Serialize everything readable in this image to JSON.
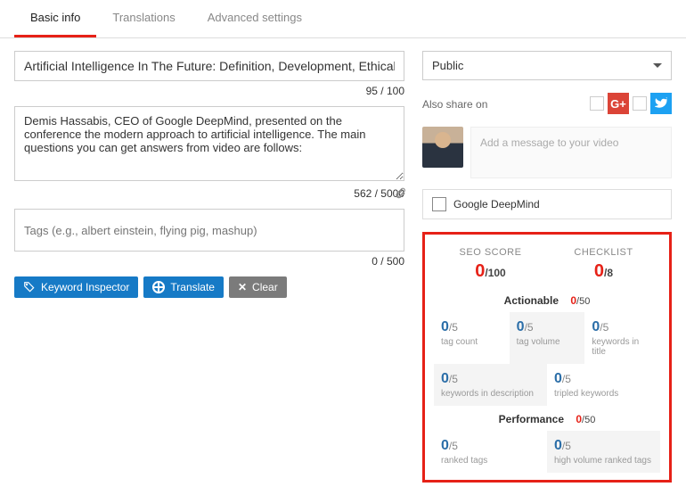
{
  "tabs": {
    "basic": "Basic info",
    "translations": "Translations",
    "advanced": "Advanced settings"
  },
  "title": {
    "value": "Artificial Intelligence In The Future: Definition, Development, Ethical Iss",
    "counter": "95 / 100"
  },
  "description": {
    "value": "Demis Hassabis, CEO of Google DeepMind, presented on the conference the modern approach to artificial intelligence. The main questions you can get answers from video are follows:",
    "counter": "562 / 5000"
  },
  "tags": {
    "placeholder": "Tags (e.g., albert einstein, flying pig, mashup)",
    "counter": "0 / 500"
  },
  "buttons": {
    "keyword": "Keyword Inspector",
    "translate": "Translate",
    "clear": "Clear"
  },
  "privacy": {
    "value": "Public"
  },
  "share": {
    "label": "Also share on",
    "msg_placeholder": "Add a message to your video"
  },
  "related_tag": "Google DeepMind",
  "seo": {
    "score_label": "SEO SCORE",
    "score": "0",
    "score_denom": "/100",
    "checklist_label": "CHECKLIST",
    "checklist": "0",
    "checklist_denom": "/8",
    "actionable": {
      "name": "Actionable",
      "score": "0",
      "denom": "/50",
      "items": [
        {
          "v": "0",
          "d": "/5",
          "label": "tag count"
        },
        {
          "v": "0",
          "d": "/5",
          "label": "tag volume"
        },
        {
          "v": "0",
          "d": "/5",
          "label": "keywords in title"
        },
        {
          "v": "0",
          "d": "/5",
          "label": "keywords in description"
        },
        {
          "v": "0",
          "d": "/5",
          "label": "tripled keywords"
        }
      ]
    },
    "performance": {
      "name": "Performance",
      "score": "0",
      "denom": "/50",
      "items": [
        {
          "v": "0",
          "d": "/5",
          "label": "ranked tags"
        },
        {
          "v": "0",
          "d": "/5",
          "label": "high volume ranked tags"
        }
      ]
    }
  }
}
